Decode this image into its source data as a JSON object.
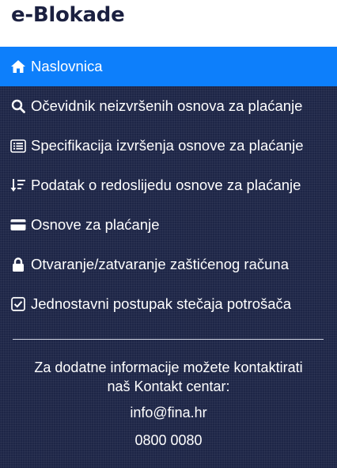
{
  "header": {
    "title": "e-Blokade"
  },
  "nav": {
    "items": [
      {
        "label": "Naslovnica",
        "icon": "home-icon",
        "active": true
      },
      {
        "label": "Očevidnik neizvršenih osnova za plaćanje",
        "icon": "search-icon"
      },
      {
        "label": "Specifikacija izvršenja osnove za plaćanje",
        "icon": "list-icon"
      },
      {
        "label": "Podatak o redoslijedu osnove za plaćanje",
        "icon": "sort-icon"
      },
      {
        "label": "Osnove za plaćanje",
        "icon": "credit-card-icon"
      },
      {
        "label": "Otvaranje/zatvaranje zaštićenog računa",
        "icon": "lock-icon"
      },
      {
        "label": "Jednostavni postupak stečaja potrošača",
        "icon": "checkbox-icon"
      }
    ]
  },
  "contact": {
    "line1": "Za dodatne informacije možete kontaktirati",
    "line2": "naš Kontakt centar:",
    "email": "info@fina.hr",
    "phone": "0800 0080"
  },
  "colors": {
    "active": "#0d7ffb",
    "sidebar": "#1e2647",
    "title": "#1b2040"
  }
}
